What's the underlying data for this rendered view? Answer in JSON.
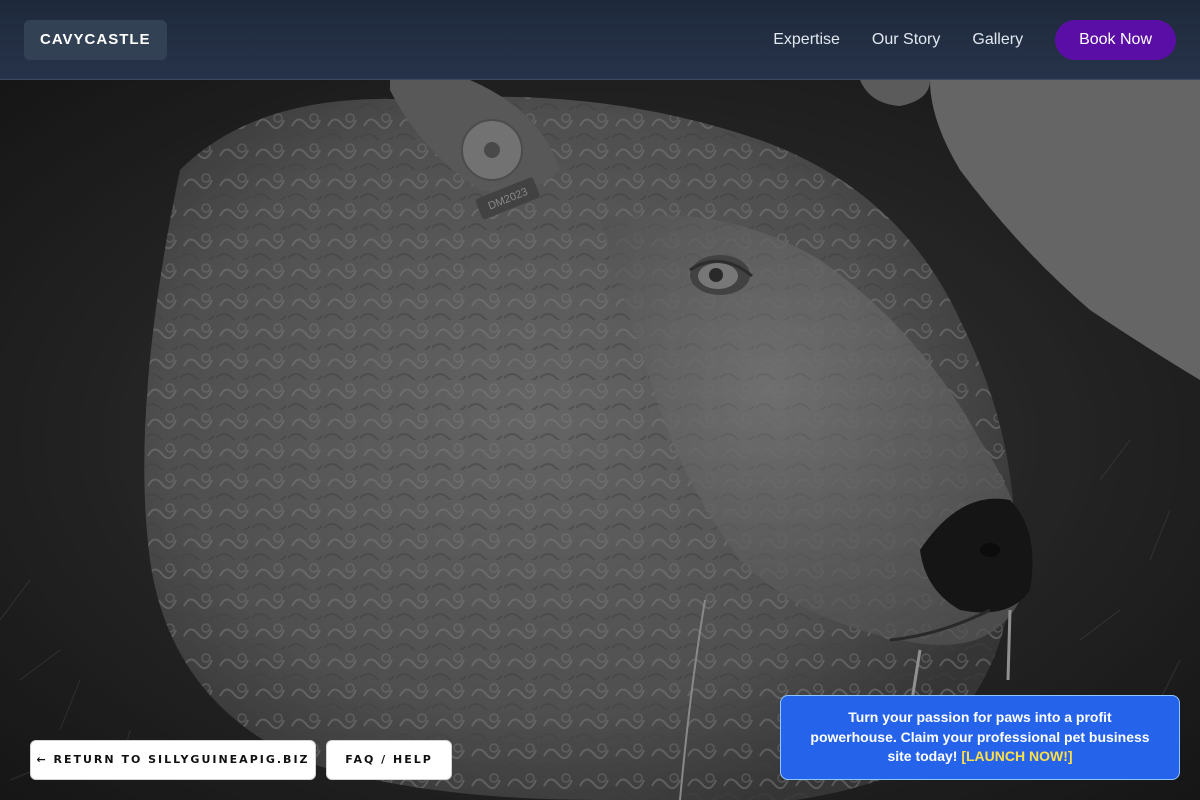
{
  "navbar": {
    "brand": "CAVYCASTLE",
    "links": [
      "Expertise",
      "Our Story",
      "Gallery"
    ],
    "cta": "Book Now",
    "cta_color": "#5b0ea6"
  },
  "hero": {
    "image": "close-up of a curly-fleeced sheep with an ear tag",
    "ear_tag_text": "DM2023"
  },
  "buttons": {
    "return": "← RETURN TO SILLYGUINEAPIG.BIZ",
    "faq": "FAQ / HELP"
  },
  "promo": {
    "text": "Turn your passion for paws into a profit powerhouse. Claim your professional pet business site today!",
    "cta": "[LAUNCH NOW!]",
    "background": "#2563eb",
    "cta_color": "#fde047"
  }
}
